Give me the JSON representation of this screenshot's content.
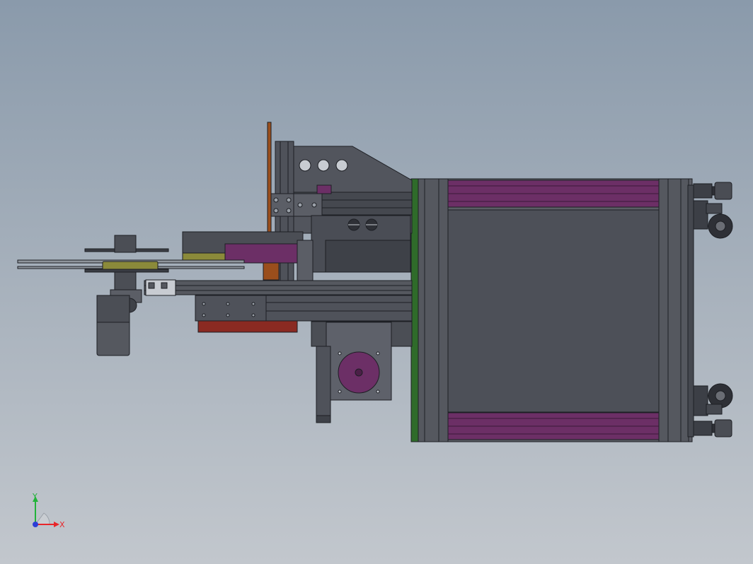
{
  "viewport": {
    "background_top": "#8a9aab",
    "background_bottom": "#c2c7cd"
  },
  "triad": {
    "x_label": "X",
    "y_label": "Y",
    "x_color": "#e8262a",
    "y_color": "#22b33a",
    "z_color": "#2d3fd6"
  },
  "colors": {
    "frame": "#4b4e55",
    "frame_dark": "#2e3036",
    "panel": "#5b5e66",
    "purple": "#6c2f66",
    "green": "#2f6b2a",
    "olive": "#8b8a3a",
    "red": "#8a2a22",
    "orange": "#9a4e1c"
  }
}
